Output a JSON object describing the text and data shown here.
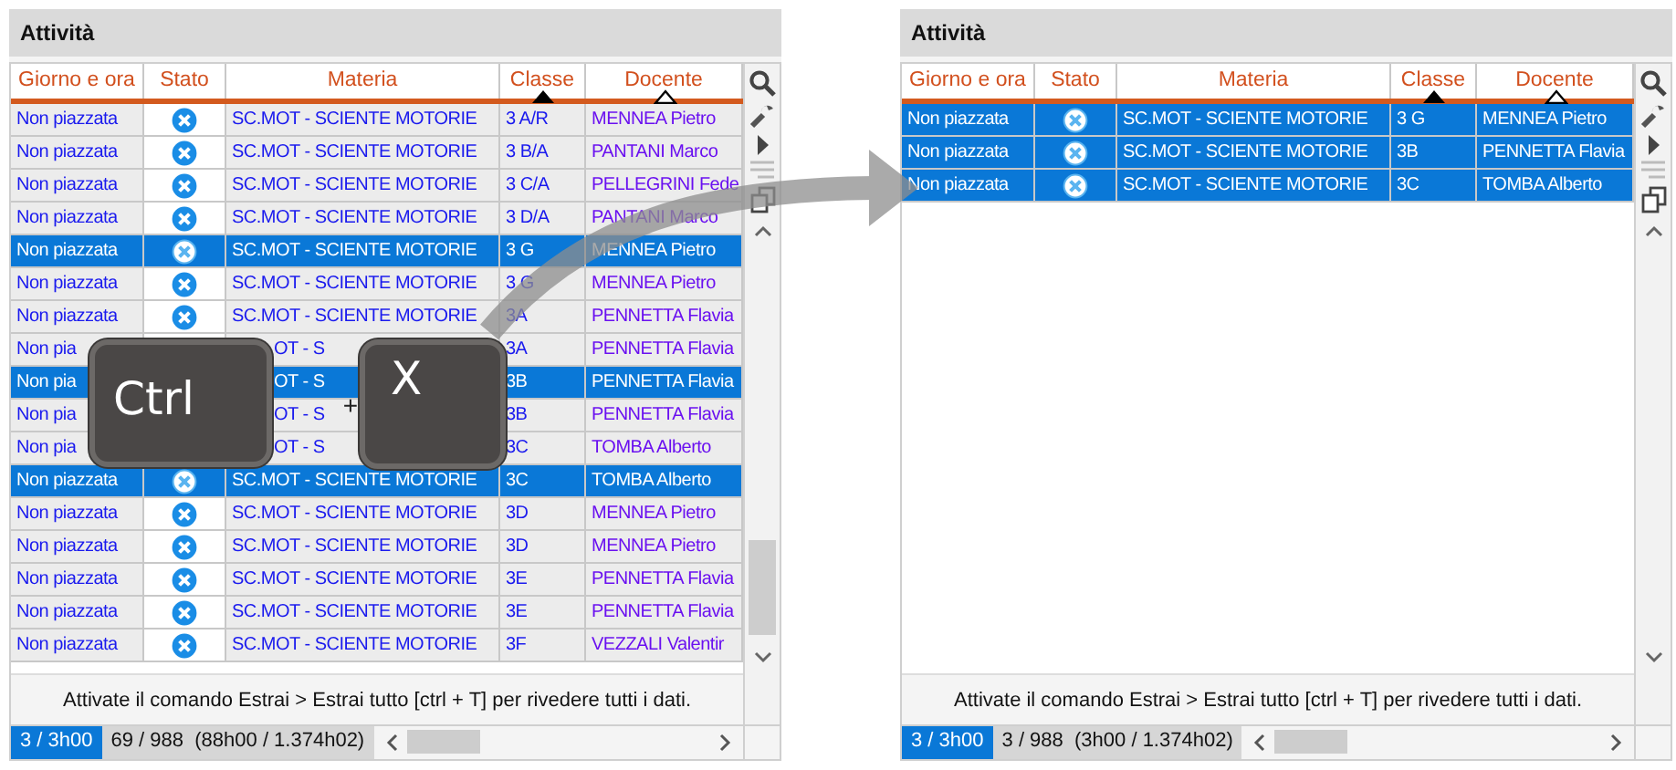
{
  "panels": [
    {
      "title": "Attività",
      "columns": [
        {
          "label": "Giorno e ora",
          "sorted": false
        },
        {
          "label": "Stato",
          "sorted": false
        },
        {
          "label": "Materia",
          "sorted": false
        },
        {
          "label": "Classe",
          "sorted": true,
          "sort_primary": true
        },
        {
          "label": "Docente",
          "sorted": true,
          "sort_primary": false
        }
      ],
      "rows": [
        {
          "kind": "row",
          "giorno": "Non piazzata",
          "materia": "SC.MOT - SCIENTE MOTORIE",
          "classe": "3 A/R",
          "docente": "MENNEA Pietro",
          "selected": false
        },
        {
          "kind": "row",
          "giorno": "Non piazzata",
          "materia": "SC.MOT - SCIENTE MOTORIE",
          "classe": "3 B/A",
          "docente": "PANTANI Marco",
          "selected": false
        },
        {
          "kind": "row",
          "giorno": "Non piazzata",
          "materia": "SC.MOT - SCIENTE MOTORIE",
          "classe": "3 C/A",
          "docente": "PELLEGRINI Fede",
          "selected": false
        },
        {
          "kind": "row",
          "giorno": "Non piazzata",
          "materia": "SC.MOT - SCIENTE MOTORIE",
          "classe": "3 D/A",
          "docente": "PANTANI Marco",
          "selected": false
        },
        {
          "kind": "row",
          "giorno": "Non piazzata",
          "materia": "SC.MOT - SCIENTE MOTORIE",
          "classe": "3 G",
          "docente": "MENNEA Pietro",
          "selected": true
        },
        {
          "kind": "row",
          "giorno": "Non piazzata",
          "materia": "SC.MOT - SCIENTE MOTORIE",
          "classe": "3 G",
          "docente": "MENNEA Pietro",
          "selected": false
        },
        {
          "kind": "row",
          "giorno": "Non piazzata",
          "materia": "SC.MOT - SCIENTE MOTORIE",
          "classe": "3A",
          "docente": "PENNETTA Flavia",
          "selected": false
        },
        {
          "kind": "covered",
          "giorno": "Non pia",
          "materia": "OT - S",
          "classe": "3A",
          "docente": "PENNETTA Flavia",
          "selected": false
        },
        {
          "kind": "covered",
          "giorno": "Non pia",
          "materia": "OT - S",
          "classe": "3B",
          "docente": "PENNETTA Flavia",
          "selected": true
        },
        {
          "kind": "covered",
          "giorno": "Non pia",
          "materia": "OT - S",
          "classe": "3B",
          "docente": "PENNETTA Flavia",
          "selected": false
        },
        {
          "kind": "covered",
          "giorno": "Non pia",
          "materia": "OT - S",
          "classe": "3C",
          "docente": "TOMBA Alberto",
          "selected": false
        },
        {
          "kind": "row",
          "giorno": "Non piazzata",
          "materia": "SC.MOT - SCIENTE MOTORIE",
          "classe": "3C",
          "docente": "TOMBA Alberto",
          "selected": true
        },
        {
          "kind": "row",
          "giorno": "Non piazzata",
          "materia": "SC.MOT - SCIENTE MOTORIE",
          "classe": "3D",
          "docente": "MENNEA Pietro",
          "selected": false
        },
        {
          "kind": "row",
          "giorno": "Non piazzata",
          "materia": "SC.MOT - SCIENTE MOTORIE",
          "classe": "3D",
          "docente": "MENNEA Pietro",
          "selected": false
        },
        {
          "kind": "row",
          "giorno": "Non piazzata",
          "materia": "SC.MOT - SCIENTE MOTORIE",
          "classe": "3E",
          "docente": "PENNETTA Flavia",
          "selected": false
        },
        {
          "kind": "row",
          "giorno": "Non piazzata",
          "materia": "SC.MOT - SCIENTE MOTORIE",
          "classe": "3E",
          "docente": "PENNETTA Flavia",
          "selected": false
        },
        {
          "kind": "row",
          "giorno": "Non piazzata",
          "materia": "SC.MOT - SCIENTE MOTORIE",
          "classe": "3F",
          "docente": "VEZZALI Valentir",
          "selected": false
        }
      ],
      "message": "Attivate il comando Estrai > Estrai tutto [ctrl + T] per rivedere tutti i dati.",
      "status": {
        "selection": "3 / 3h00",
        "summary": "69 / 988  (88h00 / 1.374h02)"
      },
      "keys": {
        "first": "Ctrl",
        "plus": "+",
        "second": "X"
      }
    },
    {
      "title": "Attività",
      "columns": [
        {
          "label": "Giorno e ora",
          "sorted": false
        },
        {
          "label": "Stato",
          "sorted": false
        },
        {
          "label": "Materia",
          "sorted": false
        },
        {
          "label": "Classe",
          "sorted": true,
          "sort_primary": true
        },
        {
          "label": "Docente",
          "sorted": true,
          "sort_primary": false
        }
      ],
      "rows": [
        {
          "kind": "row",
          "giorno": "Non piazzata",
          "materia": "SC.MOT - SCIENTE MOTORIE",
          "classe": "3 G",
          "docente": "MENNEA Pietro",
          "selected": true
        },
        {
          "kind": "row",
          "giorno": "Non piazzata",
          "materia": "SC.MOT - SCIENTE MOTORIE",
          "classe": "3B",
          "docente": "PENNETTA Flavia",
          "selected": true
        },
        {
          "kind": "row",
          "giorno": "Non piazzata",
          "materia": "SC.MOT - SCIENTE MOTORIE",
          "classe": "3C",
          "docente": "TOMBA Alberto",
          "selected": true
        }
      ],
      "message": "Attivate il comando Estrai > Estrai tutto [ctrl + T] per rivedere tutti i dati.",
      "status": {
        "selection": "3 / 3h00",
        "summary": "3 / 988  (3h00 / 1.374h02)"
      }
    }
  ]
}
